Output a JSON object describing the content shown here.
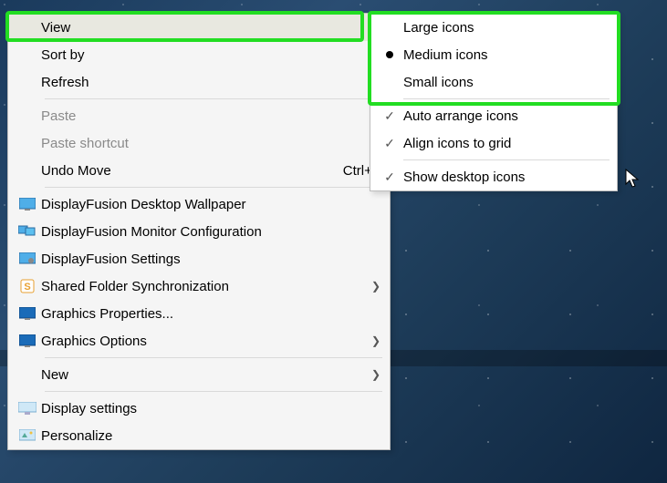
{
  "mainMenu": {
    "view": "View",
    "sortBy": "Sort by",
    "refresh": "Refresh",
    "paste": "Paste",
    "pasteShortcut": "Paste shortcut",
    "undoMove": "Undo Move",
    "undoMoveShortcut": "Ctrl+Z",
    "dfWallpaper": "DisplayFusion Desktop Wallpaper",
    "dfMonitor": "DisplayFusion Monitor Configuration",
    "dfSettings": "DisplayFusion Settings",
    "sharedFolder": "Shared Folder Synchronization",
    "graphicsProps": "Graphics Properties...",
    "graphicsOptions": "Graphics Options",
    "new": "New",
    "displaySettings": "Display settings",
    "personalize": "Personalize"
  },
  "subMenu": {
    "largeIcons": "Large icons",
    "mediumIcons": "Medium icons",
    "smallIcons": "Small icons",
    "autoArrange": "Auto arrange icons",
    "alignGrid": "Align icons to grid",
    "showDesktop": "Show desktop icons"
  }
}
